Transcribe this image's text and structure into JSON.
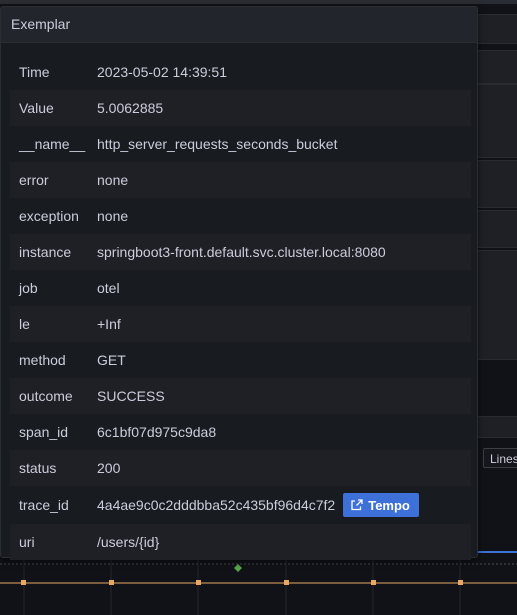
{
  "tooltip": {
    "title": "Exemplar",
    "rows": [
      {
        "key": "Time",
        "value": "2023-05-02 14:39:51"
      },
      {
        "key": "Value",
        "value": "5.0062885"
      },
      {
        "key": "__name__",
        "value": "http_server_requests_seconds_bucket"
      },
      {
        "key": "error",
        "value": "none"
      },
      {
        "key": "exception",
        "value": "none"
      },
      {
        "key": "instance",
        "value": "springboot3-front.default.svc.cluster.local:8080"
      },
      {
        "key": "job",
        "value": "otel"
      },
      {
        "key": "le",
        "value": "+Inf"
      },
      {
        "key": "method",
        "value": "GET"
      },
      {
        "key": "outcome",
        "value": "SUCCESS"
      },
      {
        "key": "span_id",
        "value": "6c1bf07d975c9da8"
      },
      {
        "key": "status",
        "value": "200"
      },
      {
        "key": "trace_id",
        "value": "4a4ae9c0c2dddbba52c435bf96d4c7f2"
      },
      {
        "key": "uri",
        "value": "/users/{id}"
      }
    ],
    "tempo_button": {
      "label": "Tempo",
      "icon": "external-link-icon",
      "color": "#3d71d9"
    }
  },
  "background": {
    "legend_button_label": "Lines"
  },
  "colors": {
    "series_line": "#e8a864",
    "exemplar_marker": "#56a64b",
    "accent": "#3d71d9"
  }
}
